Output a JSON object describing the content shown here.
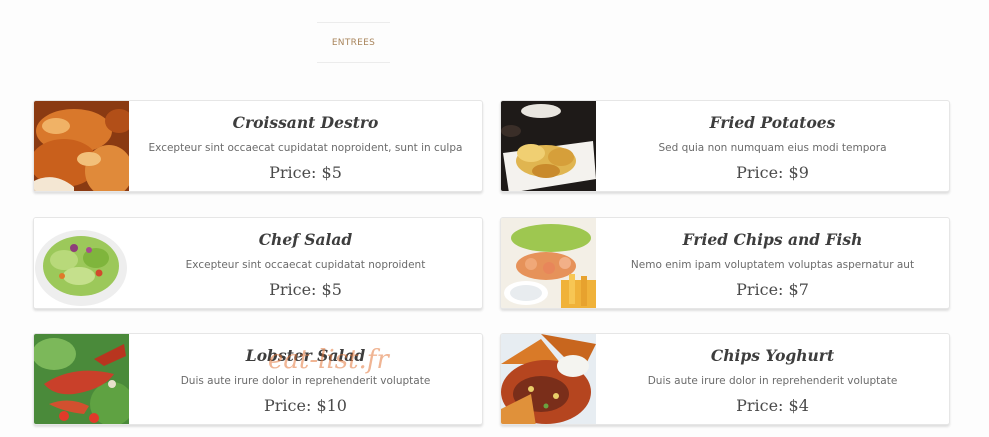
{
  "tab": {
    "label": "ENTREES"
  },
  "items": [
    {
      "title": "Croissant Destro",
      "desc": "Excepteur sint occaecat cupidatat noproident, sunt in culpa",
      "price": "Price: $5",
      "image": "croissant-image"
    },
    {
      "title": "Fried Potatoes",
      "desc": "Sed quia non numquam eius modi tempora",
      "price": "Price: $9",
      "image": "fried-potatoes-image"
    },
    {
      "title": "Chef Salad",
      "desc": "Excepteur sint occaecat cupidatat noproident",
      "price": "Price: $5",
      "image": "chef-salad-image"
    },
    {
      "title": "Fried Chips and Fish",
      "desc": "Nemo enim ipam voluptatem voluptas aspernatur aut",
      "price": "Price: $7",
      "image": "chips-and-fish-image"
    },
    {
      "title": "Lobster Salad",
      "desc": "Duis aute irure dolor in reprehenderit voluptate",
      "price": "Price: $10",
      "image": "lobster-salad-image"
    },
    {
      "title": "Chips Yoghurt",
      "desc": "Duis aute irure dolor in reprehenderit voluptate",
      "price": "Price: $4",
      "image": "chips-yoghurt-image"
    }
  ],
  "watermark": "eat-list.fr"
}
